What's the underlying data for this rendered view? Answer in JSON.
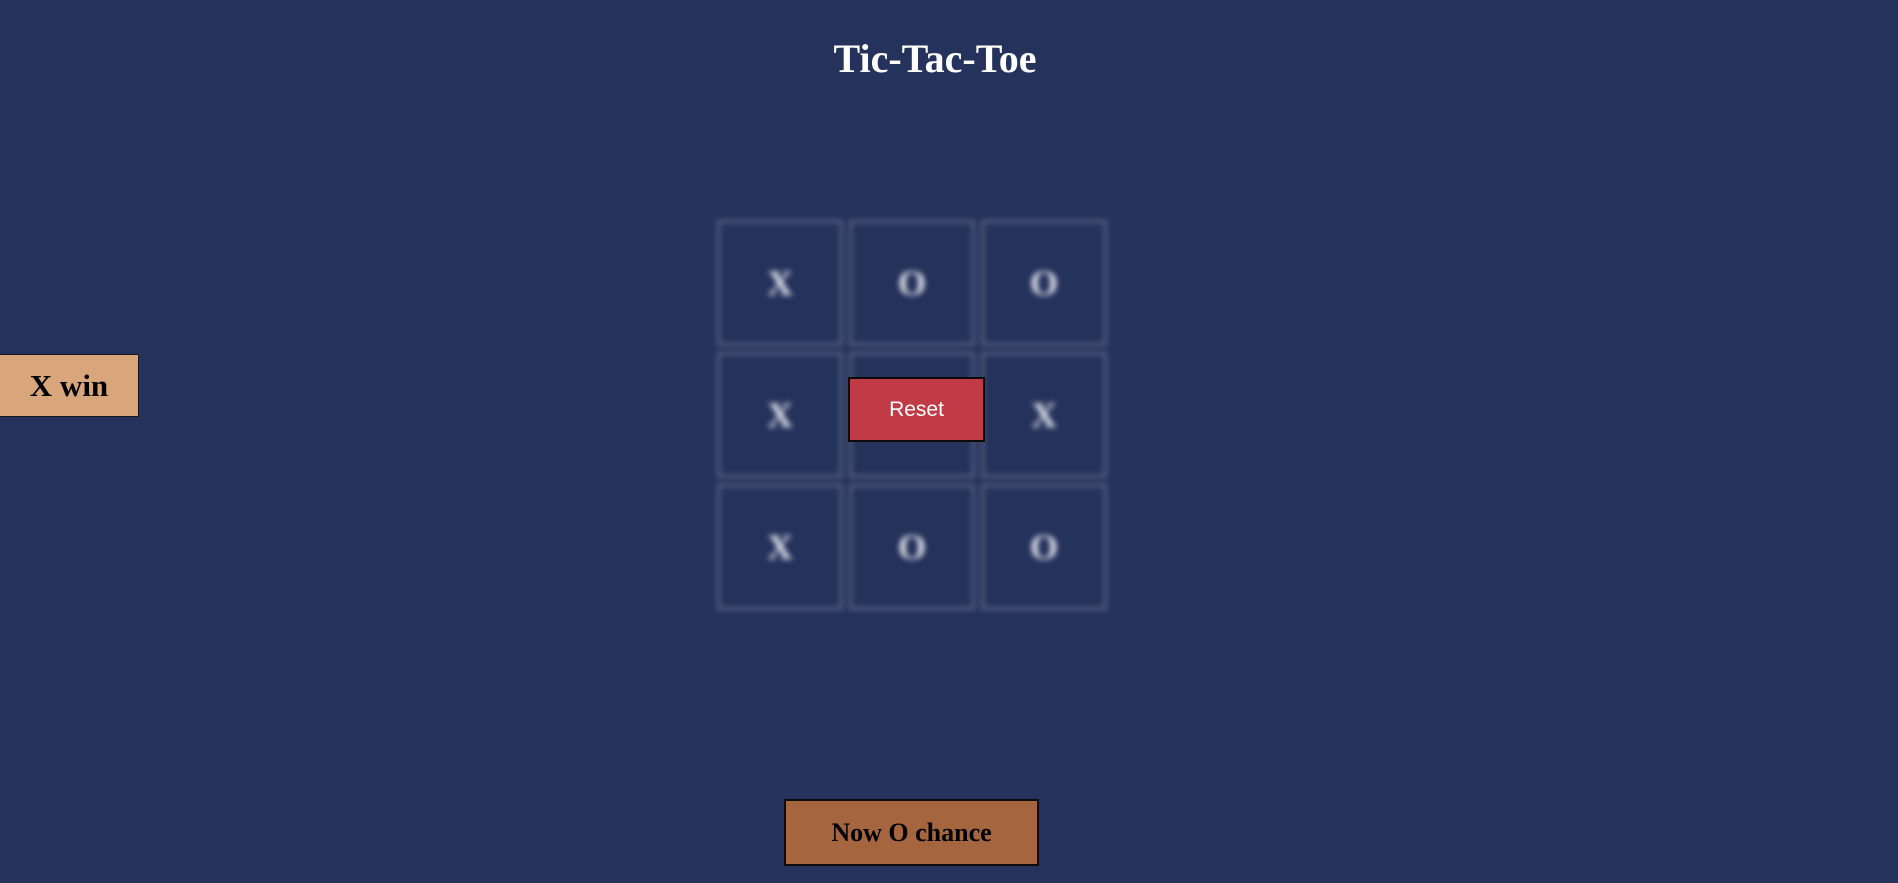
{
  "title": "Tic-Tac-Toe",
  "board": {
    "cells": [
      "X",
      "O",
      "O",
      "X",
      "",
      "X",
      "X",
      "O",
      "O"
    ]
  },
  "reset_button": {
    "label": "Reset"
  },
  "win_message": "X win",
  "turn_indicator": "Now O chance",
  "colors": {
    "background": "#25325c",
    "reset": "#c13b47",
    "win_box": "#d9a57a",
    "turn_box": "#a5663f"
  }
}
